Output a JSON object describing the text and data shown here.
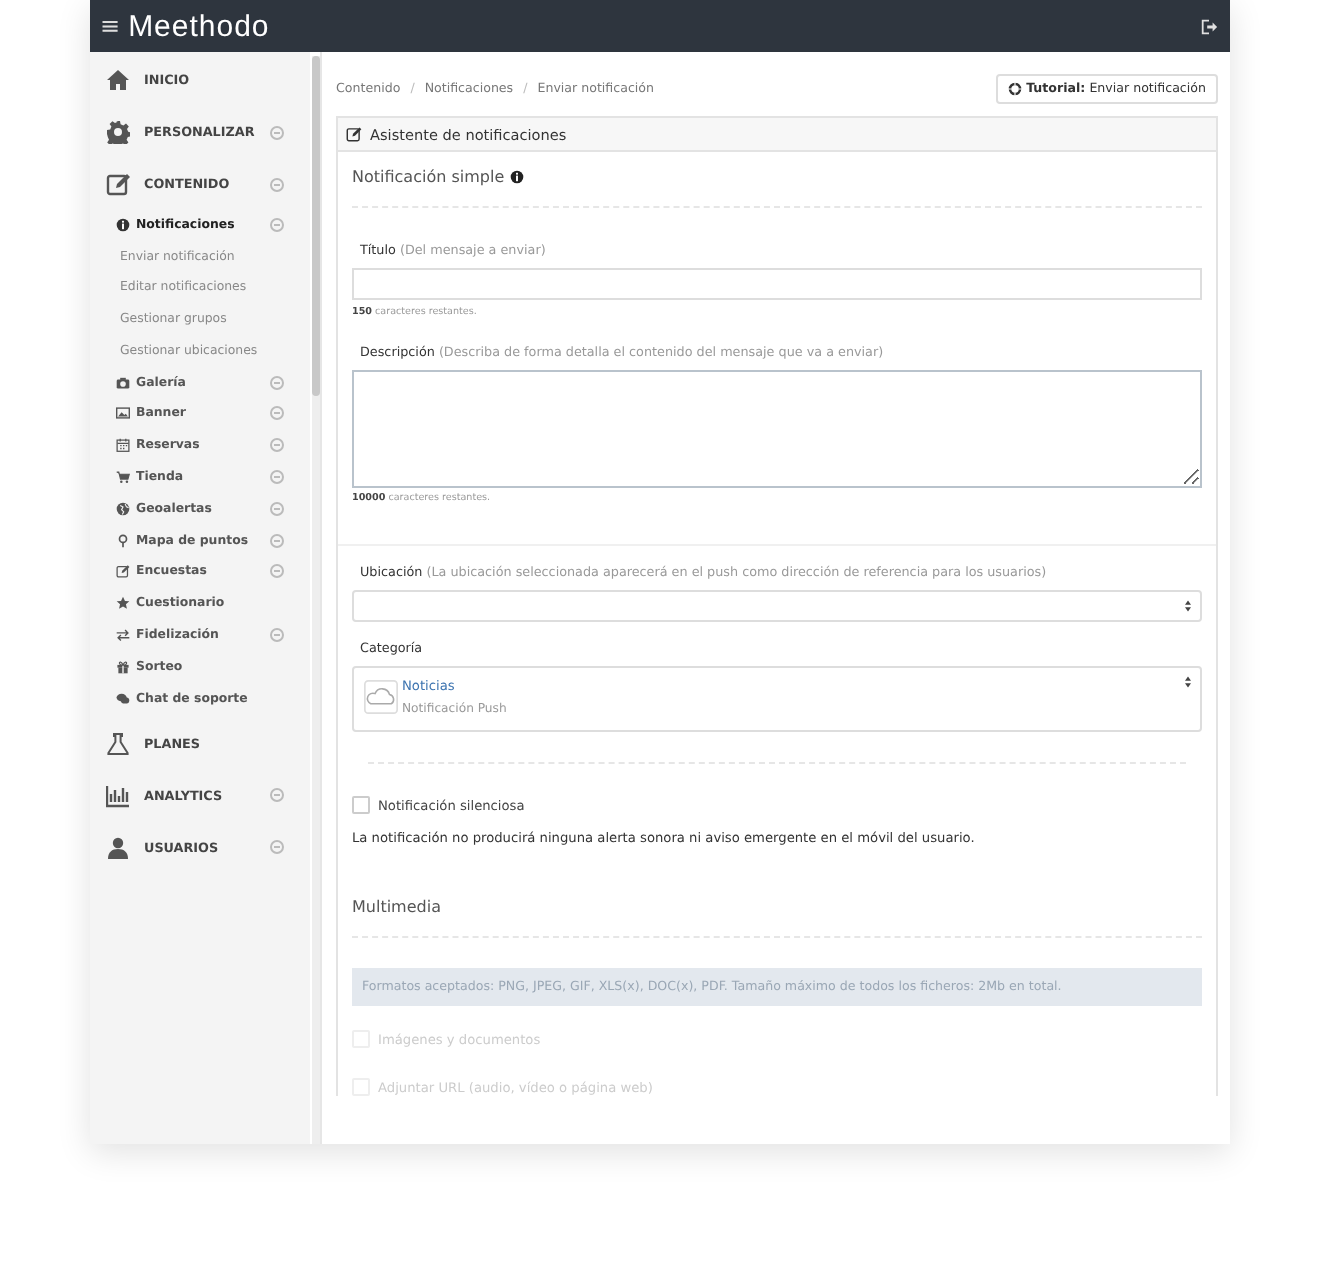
{
  "topbar": {
    "menu_glyph": "≡",
    "logo": "Meethodo"
  },
  "sidebar": {
    "items": [
      {
        "label": "INICIO",
        "expandable": false
      },
      {
        "label": "PERSONALIZAR",
        "expandable": true
      },
      {
        "label": "CONTENIDO",
        "expandable": true,
        "children": [
          {
            "label": "Notificaciones",
            "expandable": true,
            "children": [
              {
                "label": "Enviar notificación"
              },
              {
                "label": "Editar notificaciones"
              },
              {
                "label": "Gestionar grupos"
              },
              {
                "label": "Gestionar ubicaciones"
              }
            ]
          },
          {
            "label": "Galería",
            "expandable": true
          },
          {
            "label": "Banner",
            "expandable": true
          },
          {
            "label": "Reservas",
            "expandable": true
          },
          {
            "label": "Tienda",
            "expandable": true
          },
          {
            "label": "Geoalertas",
            "expandable": true
          },
          {
            "label": "Mapa de puntos",
            "expandable": true
          },
          {
            "label": "Encuestas",
            "expandable": true
          },
          {
            "label": "Cuestionario",
            "expandable": false
          },
          {
            "label": "Fidelización",
            "expandable": true
          },
          {
            "label": "Sorteo",
            "expandable": false
          },
          {
            "label": "Chat de soporte",
            "expandable": false
          }
        ]
      },
      {
        "label": "PLANES",
        "expandable": false
      },
      {
        "label": "ANALYTICS",
        "expandable": true
      },
      {
        "label": "USUARIOS",
        "expandable": true
      }
    ]
  },
  "breadcrumb": {
    "items": [
      "Contenido",
      "Notificaciones",
      "Enviar notificación"
    ],
    "separator": "/"
  },
  "tutorial_button": "**Tutorial:** Enviar notificación",
  "panel": {
    "title": "Asistente de notificaciones",
    "section_title": "Notificación simple",
    "title_field": {
      "label": "Título",
      "hint": "(Del mensaje a enviar)",
      "counter": "**150** caracteres restantes."
    },
    "description_field": {
      "label": "Descripción",
      "hint": "(Describa de forma detalla el contenido del mensaje que va a enviar)",
      "counter": "**10000** caracteres restantes."
    },
    "location_field": {
      "label": "Ubicación",
      "hint": "(La ubicación seleccionada aparecerá en el push como dirección de referencia para los usuarios)"
    },
    "category_field": {
      "label": "Categoría",
      "option_title": "Noticias",
      "option_subtitle": "Notificación Push"
    },
    "silent": {
      "label": "Notificación silenciosa",
      "checked": false
    },
    "silent_note": "La notificación no producirá ninguna alerta sonora ni aviso emergente en el móvil del usuario.",
    "multimedia_title": "Multimedia",
    "multimedia_info": "Formatos aceptados: PNG, JPEG, GIF, XLS(x), DOC(x), PDF. Tamaño máximo de todos los ficheros: 2Mb en total.",
    "multimedia_options": [
      {
        "label": "Imágenes y documentos",
        "checked": false,
        "disabled": true
      },
      {
        "label": "Adjuntar URL (audio, vídeo o página web)",
        "checked": false,
        "disabled": true
      }
    ]
  }
}
